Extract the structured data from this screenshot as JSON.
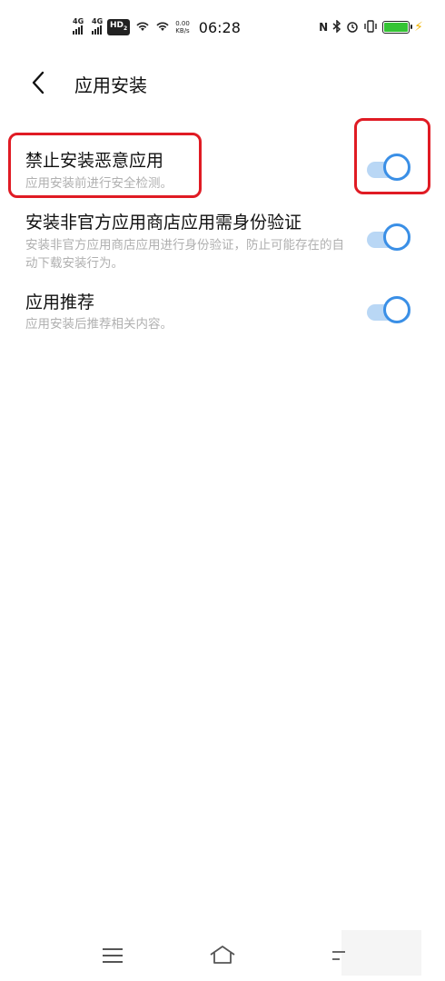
{
  "status_bar": {
    "signal1_label": "4G",
    "signal2_label": "4G",
    "hd_label": "HD",
    "hd_sub": "2",
    "speed_value": "0.00",
    "speed_unit": "KB/s",
    "time": "06:28",
    "battery_level": 1.0,
    "icons": [
      "nfc-icon",
      "bluetooth-icon",
      "alarm-icon",
      "vibrate-icon",
      "battery-icon",
      "charging-icon"
    ]
  },
  "header": {
    "title": "应用安装",
    "back_icon": "chevron-left-icon"
  },
  "settings": [
    {
      "title": "禁止安装恶意应用",
      "description": "应用安装前进行安全检测。",
      "enabled": true
    },
    {
      "title": "安装非官方应用商店应用需身份验证",
      "description": "安装非官方应用商店应用进行身份验证，防止可能存在的自动下载安装行为。",
      "enabled": true
    },
    {
      "title": "应用推荐",
      "description": "应用安装后推荐相关内容。",
      "enabled": true
    }
  ],
  "colors": {
    "accent": "#3a8fe6",
    "track": "#b9d7f5",
    "highlight": "#e01b24",
    "secondary_text": "#b0b0b0"
  },
  "nav_bar": {
    "icons": [
      "menu-icon",
      "home-icon",
      "back-icon"
    ]
  }
}
